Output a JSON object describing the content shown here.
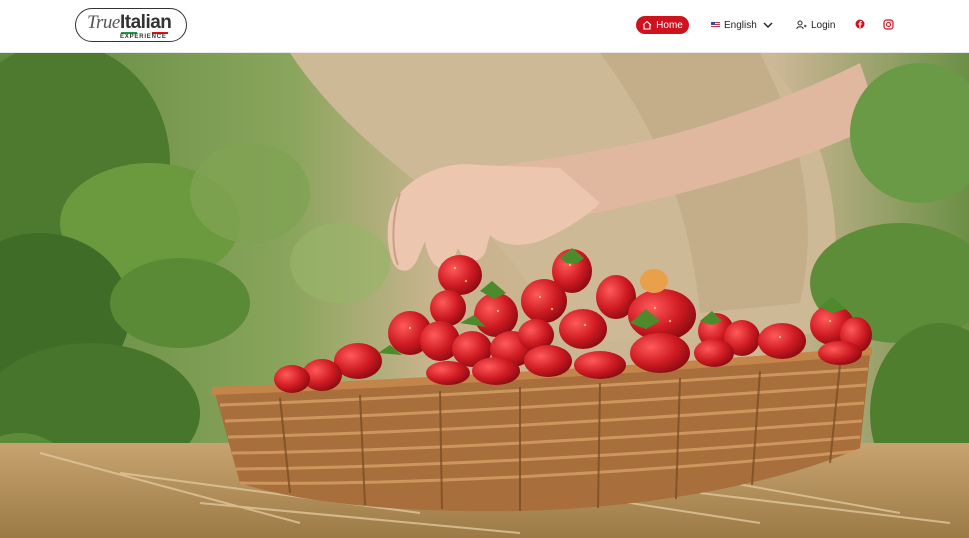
{
  "logo": {
    "text_a": "True",
    "text_b": "Italian",
    "subtitle": "EXPERIENCE"
  },
  "nav": {
    "home_label": "Home",
    "language_label": "English",
    "login_label": "Login"
  },
  "social": [
    "facebook-icon",
    "instagram-icon"
  ],
  "colors": {
    "brand_red": "#d0121e",
    "flag_green": "#1f9a46",
    "flag_red": "#d0121e"
  },
  "hero": {
    "image_subject": "hands picking strawberries into a wicker basket in a strawberry field"
  }
}
